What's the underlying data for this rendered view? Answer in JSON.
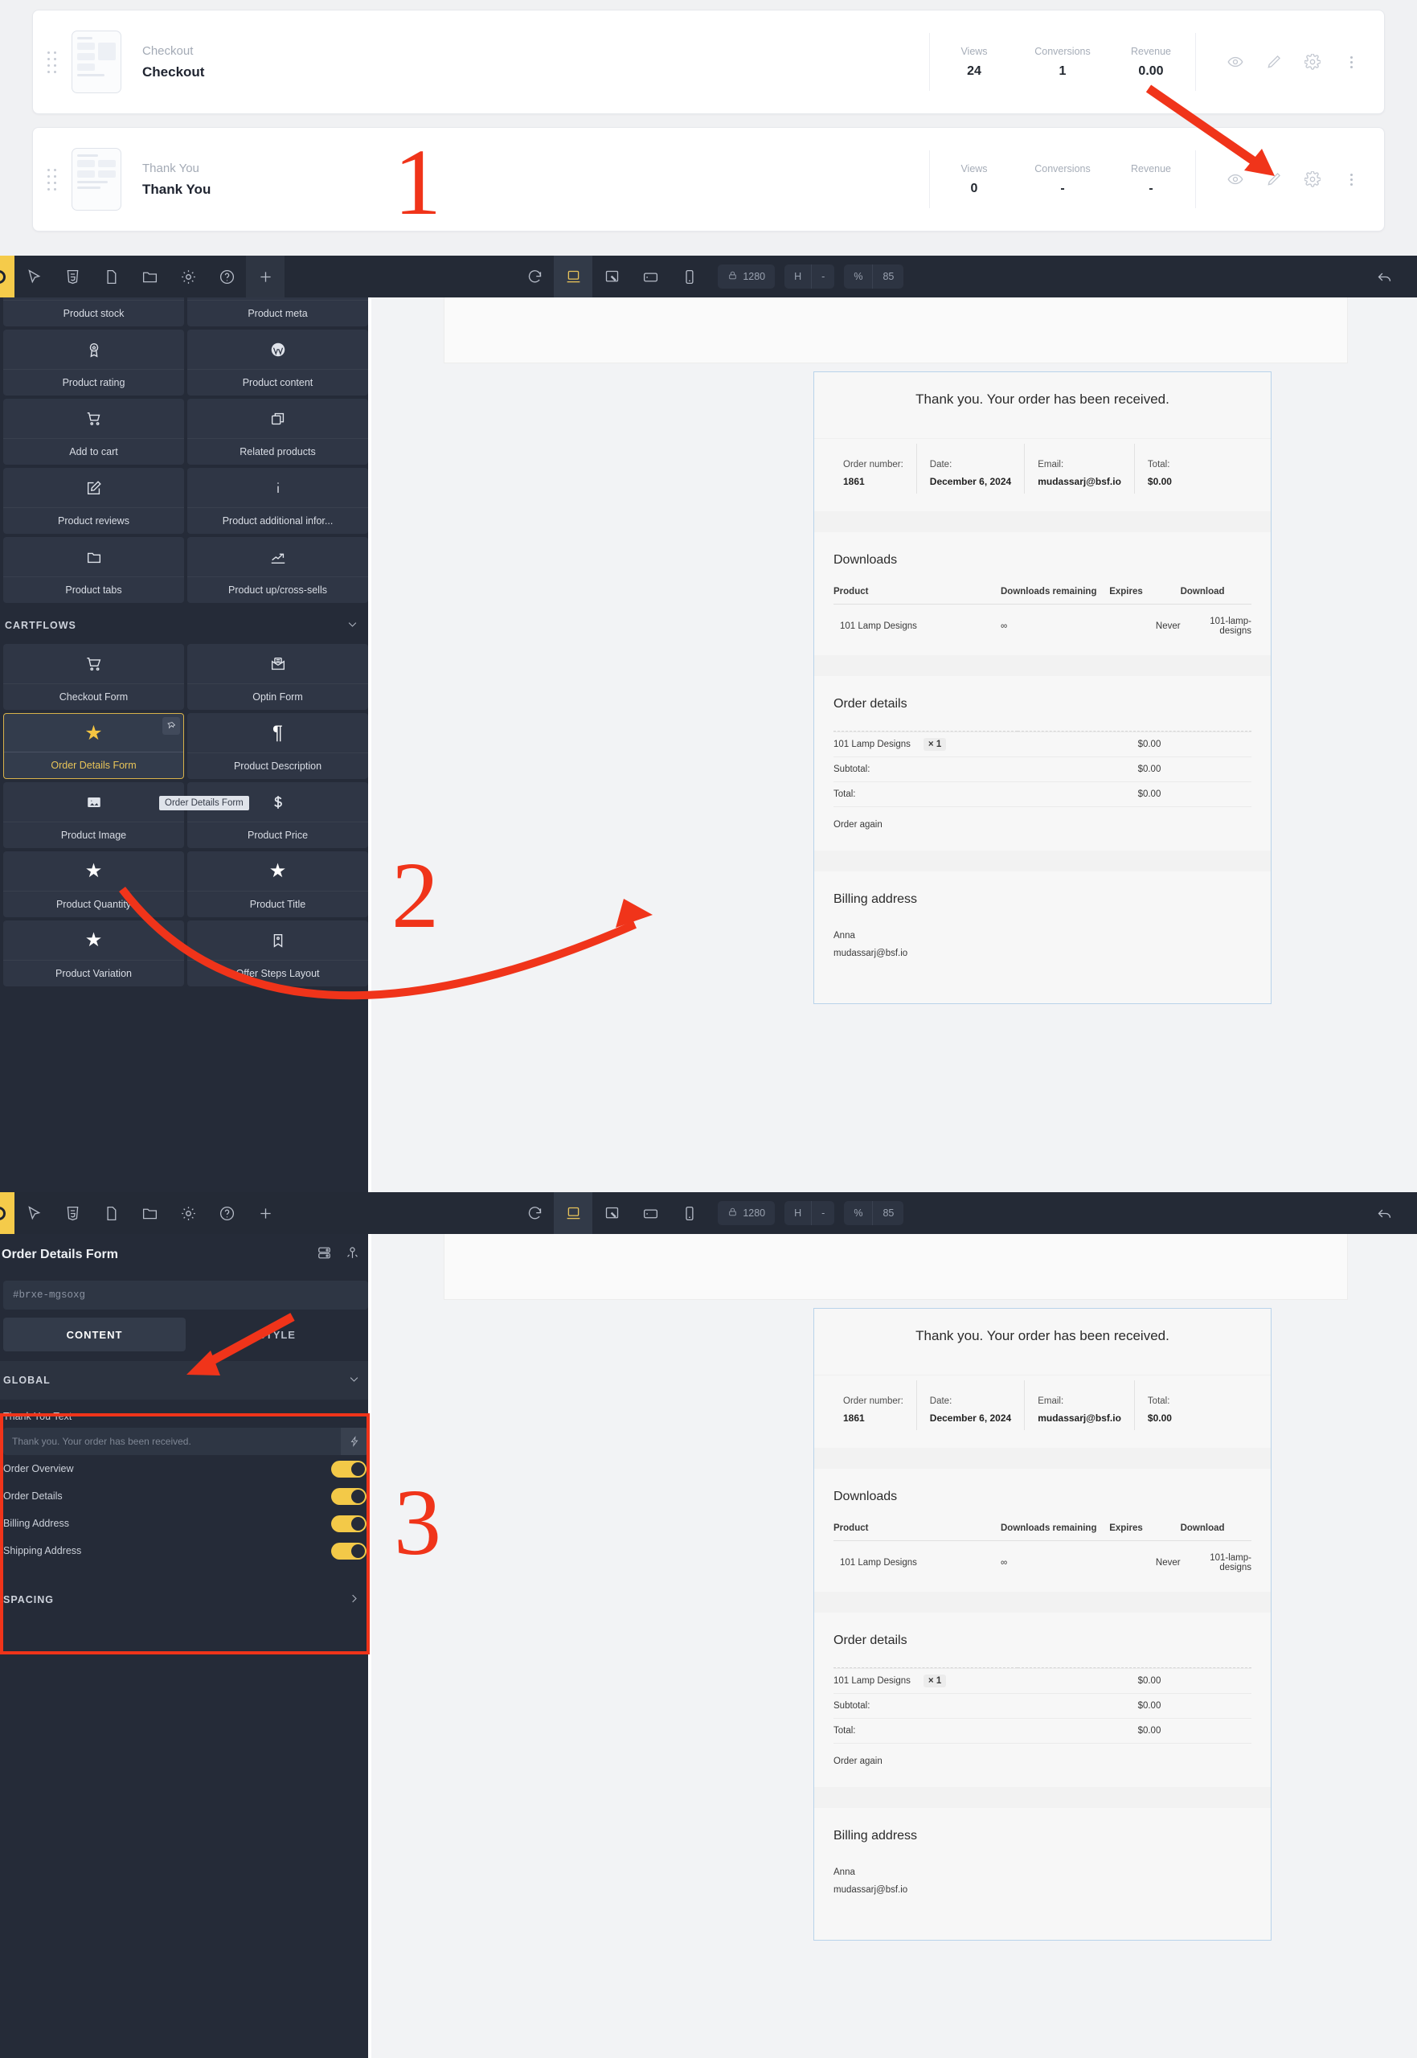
{
  "steps": {
    "cards": [
      {
        "type": "Checkout",
        "title": "Checkout",
        "metrics": [
          {
            "label": "Views",
            "value": "24"
          },
          {
            "label": "Conversions",
            "value": "1"
          },
          {
            "label": "Revenue",
            "value": "0.00"
          }
        ]
      },
      {
        "type": "Thank You",
        "title": "Thank You",
        "metrics": [
          {
            "label": "Views",
            "value": "0"
          },
          {
            "label": "Conversions",
            "value": "-"
          },
          {
            "label": "Revenue",
            "value": "-"
          }
        ]
      }
    ],
    "action_icons": [
      "eye-icon",
      "pencil-icon",
      "gear-icon",
      "more-vertical-icon"
    ]
  },
  "toolbar": {
    "left_icons": [
      "bricks-logo",
      "cursor-icon",
      "css-icon",
      "page-icon",
      "folder-icon",
      "gear-icon",
      "help-icon",
      "plus-icon"
    ],
    "center_icons": [
      "sync-icon",
      "desktop-icon",
      "device-preview-icon",
      "tablet-icon",
      "mobile-icon"
    ],
    "width_label": "1280",
    "width_icon": "lock-icon",
    "height_label": "-",
    "height_prefix": "H",
    "zoom_label": "85",
    "zoom_prefix": "%",
    "right_icon": "undo-icon"
  },
  "elements_panel": {
    "partial_top_row": [
      {
        "label": "Product stock",
        "icon": "stock-icon"
      },
      {
        "label": "Product meta",
        "icon": "meta-icon"
      }
    ],
    "rows": [
      [
        {
          "label": "Product rating",
          "icon": "award-icon"
        },
        {
          "label": "Product content",
          "icon": "wordpress-icon"
        }
      ],
      [
        {
          "label": "Add to cart",
          "icon": "cart-icon"
        },
        {
          "label": "Related products",
          "icon": "copy-icon"
        }
      ],
      [
        {
          "label": "Product reviews",
          "icon": "edit-square-icon"
        },
        {
          "label": "Product additional infor...",
          "icon": "info-icon"
        }
      ],
      [
        {
          "label": "Product tabs",
          "icon": "folder-icon"
        },
        {
          "label": "Product up/cross-sells",
          "icon": "trend-up-icon"
        }
      ]
    ],
    "group": {
      "title": "CARTFLOWS",
      "chevron": "chevron-down-icon",
      "rows": [
        [
          {
            "label": "Checkout Form",
            "icon": "cart-icon",
            "selected": false
          },
          {
            "label": "Optin Form",
            "icon": "envelope-icon",
            "selected": false
          }
        ],
        [
          {
            "label": "Order Details Form",
            "icon": "star-icon",
            "selected": true,
            "pin": "pin-icon"
          },
          {
            "label": "Product Description",
            "icon": "paragraph-icon",
            "selected": false
          }
        ],
        [
          {
            "label": "Product Image",
            "icon": "image-icon",
            "selected": false
          },
          {
            "label": "Product Price",
            "icon": "dollar-icon",
            "selected": false
          }
        ],
        [
          {
            "label": "Product Quantity",
            "icon": "star-icon",
            "selected": false
          },
          {
            "label": "Product Title",
            "icon": "star-icon",
            "selected": false
          }
        ],
        [
          {
            "label": "Product Variation",
            "icon": "star-icon",
            "selected": false
          },
          {
            "label": "Offer Steps Layout",
            "icon": "bookmark-icon",
            "selected": false
          }
        ]
      ]
    },
    "tooltip": "Order Details Form"
  },
  "settings_panel": {
    "title": "Order Details Form",
    "header_icons": [
      "duplicate-icon",
      "anchor-icon"
    ],
    "element_id": "#brxe-mgsoxg",
    "tabs": [
      {
        "label": "CONTENT",
        "active": true
      },
      {
        "label": "STYLE",
        "active": false
      }
    ],
    "sections": [
      {
        "label": "GLOBAL",
        "expanded": true,
        "chevron": "chevron-down-icon"
      },
      {
        "label": "SPACING",
        "expanded": false,
        "chevron": "chevron-right-icon"
      }
    ],
    "thank_you_text": {
      "label": "Thank You Text",
      "placeholder": "Thank you. Your order has been received.",
      "dynamic_icon": "lightning-icon"
    },
    "toggles": [
      {
        "label": "Order Overview",
        "on": true
      },
      {
        "label": "Order Details",
        "on": true
      },
      {
        "label": "Billing Address",
        "on": true
      },
      {
        "label": "Shipping Address",
        "on": true
      }
    ]
  },
  "preview": {
    "heading": "Thank you. Your order has been received.",
    "overview": [
      {
        "label": "Order number:",
        "value": "1861"
      },
      {
        "label": "Date:",
        "value": "December 6, 2024"
      },
      {
        "label": "Email:",
        "value": "mudassarj@bsf.io"
      },
      {
        "label": "Total:",
        "value": "$0.00"
      }
    ],
    "downloads": {
      "title": "Downloads",
      "headers": [
        "Product",
        "Downloads remaining",
        "Expires",
        "Download"
      ],
      "rows": [
        [
          "101 Lamp Designs",
          "∞",
          "Never",
          "101-lamp-designs"
        ]
      ]
    },
    "order_details": {
      "title": "Order details",
      "line_item": {
        "name": "101 Lamp Designs",
        "qty": "× 1",
        "price": "$0.00"
      },
      "subtotal_label": "Subtotal:",
      "subtotal_value": "$0.00",
      "total_label": "Total:",
      "total_value": "$0.00",
      "order_again": "Order again"
    },
    "billing": {
      "title": "Billing address",
      "name": "Anna",
      "email": "mudassarj@bsf.io"
    }
  },
  "annotations": {
    "marks": [
      "1",
      "2",
      "3"
    ],
    "color": "#f0341a"
  }
}
